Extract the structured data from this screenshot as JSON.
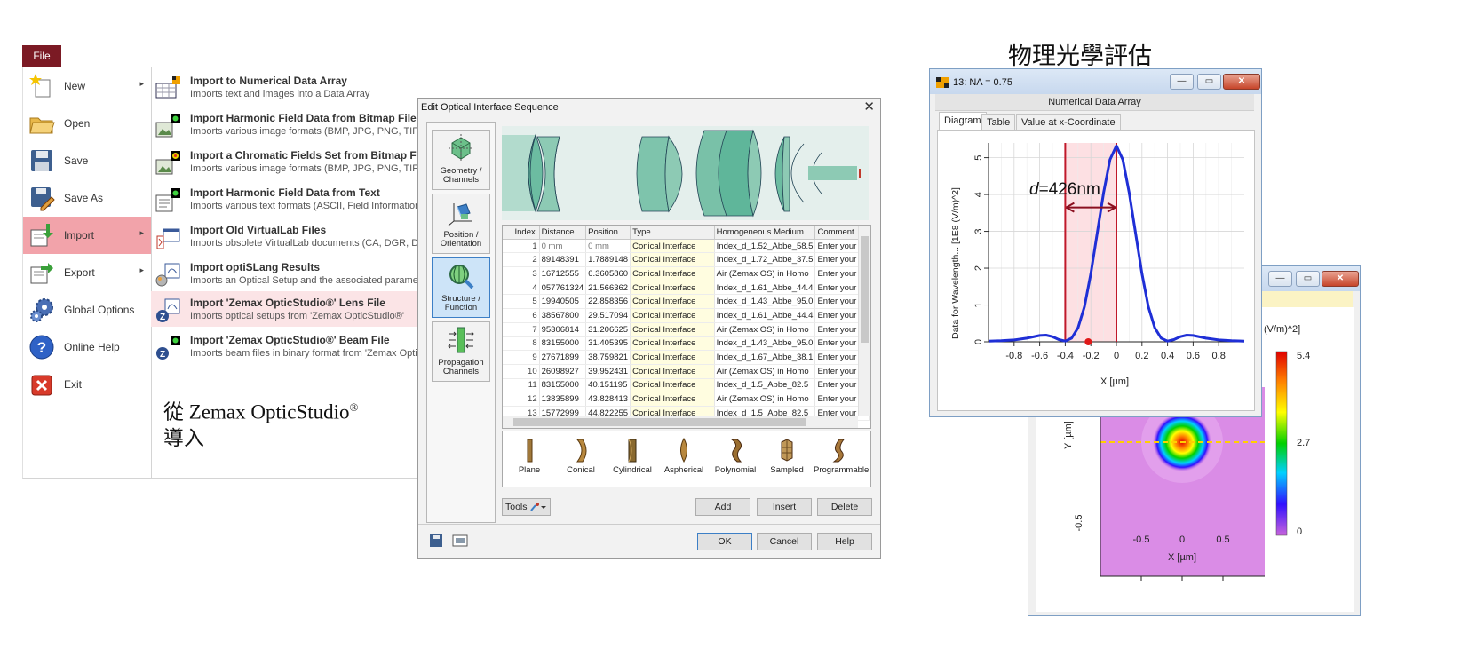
{
  "file_menu": {
    "tab": "File",
    "items": [
      {
        "label": "New",
        "icon": "new-star-icon",
        "has_submenu": true
      },
      {
        "label": "Open",
        "icon": "open-folder-icon",
        "has_submenu": false
      },
      {
        "label": "Save",
        "icon": "save-disk-icon",
        "has_submenu": false
      },
      {
        "label": "Save As",
        "icon": "save-as-icon",
        "has_submenu": false
      },
      {
        "label": "Import",
        "icon": "import-icon",
        "has_submenu": true
      },
      {
        "label": "Export",
        "icon": "export-icon",
        "has_submenu": true
      },
      {
        "label": "Global Options",
        "icon": "gears-icon",
        "has_submenu": false
      },
      {
        "label": "Online Help",
        "icon": "help-icon",
        "has_submenu": false
      },
      {
        "label": "Exit",
        "icon": "exit-icon",
        "has_submenu": false
      }
    ],
    "submenu_arrow": "▸",
    "import_items": [
      {
        "title": "Import to Numerical Data Array",
        "desc": "Imports text and images into a Data Array",
        "icon": "data-array-icon"
      },
      {
        "title": "Import Harmonic Field Data from Bitmap File",
        "desc": "Imports various image formats (BMP, JPG, PNG, TIF",
        "icon": "bitmap-field-icon"
      },
      {
        "title": "Import a Chromatic Fields Set from Bitmap F",
        "desc": "Imports various image formats (BMP, JPG, PNG, TIF",
        "icon": "chromatic-field-icon"
      },
      {
        "title": "Import Harmonic Field Data from Text",
        "desc": "Imports various text formats (ASCII, Field Information,",
        "icon": "text-field-icon"
      },
      {
        "title": "Import Old VirtualLab Files",
        "desc": "Imports obsolete VirtualLab documents (CA, DGR, D",
        "icon": "old-files-icon"
      },
      {
        "title": "Import optiSLang Results",
        "desc": "Imports an Optical Setup and the associated parame",
        "icon": "optislang-icon"
      },
      {
        "title": "Import 'Zemax OpticStudio®' Lens File",
        "desc": "Imports optical setups from 'Zemax OpticStudio®'",
        "icon": "zemax-lens-icon"
      },
      {
        "title": "Import 'Zemax OpticStudio®' Beam File",
        "desc": "Imports beam files in binary format from 'Zemax Optic",
        "icon": "zemax-beam-icon"
      }
    ]
  },
  "caption_import": {
    "line1": "從 Zemax   OpticStudio",
    "sup": "®",
    "line2": "導入"
  },
  "caption_physics": "物理光學評估",
  "dialog": {
    "title": "Edit Optical Interface Sequence",
    "close": "✕",
    "sidebar": [
      {
        "label": "Geometry / Channels",
        "icon": "geometry-cube-icon"
      },
      {
        "label": "Position / Orientation",
        "icon": "position-axes-icon"
      },
      {
        "label": "Structure / Function",
        "icon": "structure-lens-icon"
      },
      {
        "label": "Propagation Channels",
        "icon": "propagation-channels-icon"
      }
    ],
    "columns": [
      "",
      "Index",
      "Distance",
      "Position",
      "Type",
      "Homogeneous Medium",
      "Comment"
    ],
    "rows": [
      [
        "1",
        "0 mm",
        "0 mm",
        "Conical Interface",
        "Index_d_1.52_Abbe_58.5",
        "Enter your co"
      ],
      [
        "2",
        "89148391",
        "1.7889148",
        "Conical Interface",
        "Index_d_1.72_Abbe_37.5",
        "Enter your co"
      ],
      [
        "3",
        "16712555",
        "6.3605860",
        "Conical Interface",
        "Air (Zemax OS) in Homo",
        "Enter your co"
      ],
      [
        "4",
        "057761324",
        "21.566362",
        "Conical Interface",
        "Index_d_1.61_Abbe_44.4",
        "Enter your co"
      ],
      [
        "5",
        "19940505",
        "22.858356",
        "Conical Interface",
        "Index_d_1.43_Abbe_95.0",
        "Enter your co"
      ],
      [
        "6",
        "38567800",
        "29.517094",
        "Conical Interface",
        "Index_d_1.61_Abbe_44.4",
        "Enter your co"
      ],
      [
        "7",
        "95306814",
        "31.206625",
        "Conical Interface",
        "Air (Zemax OS) in Homo",
        "Enter your co"
      ],
      [
        "8",
        "83155000",
        "31.405395",
        "Conical Interface",
        "Index_d_1.43_Abbe_95.0",
        "Enter your co"
      ],
      [
        "9",
        "27671899",
        "38.759821",
        "Conical Interface",
        "Index_d_1.67_Abbe_38.1",
        "Enter your co"
      ],
      [
        "10",
        "26098927",
        "39.952431",
        "Conical Interface",
        "Air (Zemax OS) in Homo",
        "Enter your co"
      ],
      [
        "11",
        "83155000",
        "40.151195",
        "Conical Interface",
        "Index_d_1.5_Abbe_82.5",
        "Enter your co"
      ],
      [
        "12",
        "13835899",
        "43.828413",
        "Conical Interface",
        "Air (Zemax OS) in Homo",
        "Enter your co"
      ],
      [
        "13",
        "15772999",
        "44.822255",
        "Conical Interface",
        "Index_d_1.5_Abbe_82.5",
        "Enter your co"
      ]
    ],
    "shapes": [
      "Plane",
      "Conical",
      "Cylindrical",
      "Aspherical",
      "Polynomial",
      "Sampled",
      "Programmable"
    ],
    "tools_label": "Tools",
    "add": "Add",
    "insert": "Insert",
    "delete": "Delete",
    "ok": "OK",
    "cancel": "Cancel",
    "help": "Help"
  },
  "window_1d": {
    "title": "13: NA = 0.75",
    "subtitle": "Numerical Data Array",
    "tabs": [
      "Diagram",
      "Table",
      "Value at x-Coordinate"
    ],
    "annotation_prefix": "d",
    "annotation_value": "=426nm",
    "btn_min": "—",
    "btn_max": "▭",
    "btn_close": "✕"
  },
  "window_2d": {
    "btn_min": "—",
    "btn_max": "▭",
    "btn_close": "✕",
    "colorbar_unit": "(V/m)^2]",
    "colorbar_ticks": [
      "5.4",
      "2.7",
      "0"
    ]
  },
  "chart_data": [
    {
      "type": "line",
      "xlabel": "X [µm]",
      "ylabel": "Data for Wavelength... [1E8 (V/m)^2]",
      "xlim": [
        -1.0,
        1.0
      ],
      "ylim": [
        0,
        5.4
      ],
      "xticks": [
        -0.8,
        -0.6,
        -0.4,
        -0.2,
        0,
        0.2,
        0.4,
        0.6,
        0.8
      ],
      "yticks": [
        0,
        1,
        2,
        3,
        4,
        5
      ],
      "grid": true,
      "series": [
        {
          "color": "#1f2fd6",
          "x": [
            -1.0,
            -0.9,
            -0.8,
            -0.7,
            -0.6,
            -0.55,
            -0.5,
            -0.45,
            -0.4,
            -0.35,
            -0.3,
            -0.25,
            -0.2,
            -0.15,
            -0.1,
            -0.05,
            0,
            0.05,
            0.1,
            0.15,
            0.2,
            0.25,
            0.3,
            0.35,
            0.4,
            0.45,
            0.5,
            0.55,
            0.6,
            0.7,
            0.8,
            0.9,
            1.0
          ],
          "y": [
            0.02,
            0.03,
            0.05,
            0.1,
            0.17,
            0.18,
            0.14,
            0.06,
            0.02,
            0.1,
            0.38,
            0.95,
            1.85,
            2.95,
            4.05,
            4.95,
            5.32,
            4.95,
            4.05,
            2.95,
            1.85,
            0.95,
            0.38,
            0.1,
            0.02,
            0.06,
            0.14,
            0.18,
            0.17,
            0.1,
            0.05,
            0.03,
            0.02
          ]
        }
      ],
      "markers": {
        "vertical_lines_x": [
          -0.4,
          0
        ],
        "shaded_range": [
          -0.4,
          0
        ],
        "point": [
          -0.22,
          0
        ]
      }
    },
    {
      "type": "heatmap",
      "xlabel": "X [µm]",
      "ylabel": "Y [µm]",
      "xticks": [
        -0.5,
        0,
        0.5
      ],
      "yticks": [
        -0.5
      ],
      "colorbar_range": [
        0,
        5.4
      ],
      "colormap": [
        "#c864dc",
        "#3010ff",
        "#00d0ff",
        "#00d000",
        "#ffff00",
        "#ff8000",
        "#e00000"
      ],
      "spot_center": [
        0,
        0
      ]
    }
  ]
}
